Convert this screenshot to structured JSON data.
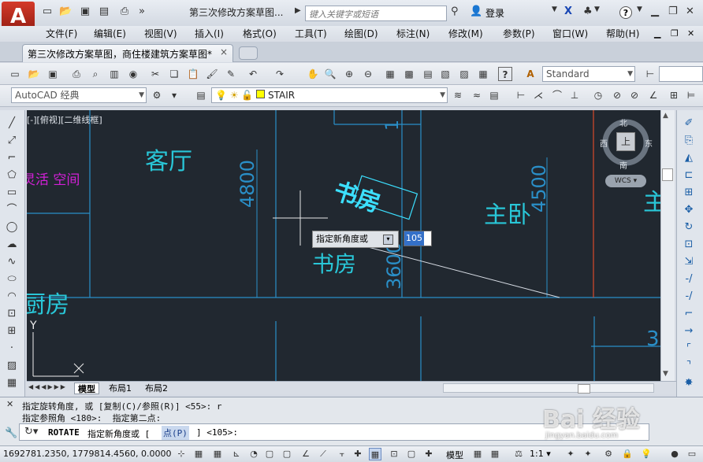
{
  "app": {
    "logo_letter": "A",
    "title": "第三次修改方案草图...",
    "search_placeholder": "键入关键字或短语",
    "login": "登录",
    "help": "?"
  },
  "menus": [
    "文件(F)",
    "编辑(E)",
    "视图(V)",
    "插入(I)",
    "格式(O)",
    "工具(T)",
    "绘图(D)",
    "标注(N)",
    "修改(M)",
    "参数(P)",
    "窗口(W)",
    "帮助(H)"
  ],
  "doc_tab": {
    "label": "第三次修改方案草图，商住楼建筑方案草图*",
    "close": "×"
  },
  "toolbar": {
    "text_style": "Standard",
    "workspace": "AutoCAD 经典",
    "layer": "STAIR"
  },
  "viewport_label": "[-][俯视][二维线框]",
  "viewcube": {
    "n": "北",
    "s": "南",
    "e": "东",
    "w": "西",
    "top": "上",
    "wcs": "WCS"
  },
  "drawing_text": {
    "living": "客厅",
    "flex": "灵活 空间",
    "kitchen": "厨房",
    "study": "书房",
    "study_rotated": "书房",
    "master": "主卧",
    "partial": "主",
    "dim_4800": "4800",
    "dim_4500": "4500",
    "dim_3600": "3600",
    "dim_3": "3",
    "dim_1": "1"
  },
  "dynamic_input": {
    "prompt": "指定新角度或",
    "value": "105"
  },
  "ucs": {
    "y": "Y",
    "x": "X"
  },
  "layout_tabs": [
    "模型",
    "布局1",
    "布局2"
  ],
  "command_history": [
    "指定旋转角度, 或 [复制(C)/参照(R)] <55>: r",
    "指定参照角 <180>:  指定第二点:"
  ],
  "command_input": {
    "cmd": "ROTATE",
    "prompt": "指定新角度或 [",
    "option": "点(P)",
    "tail": "] <105>:"
  },
  "status": {
    "coords": "1692781.2350, 1779814.4560, 0.0000",
    "model": "模型",
    "scale": "1:1"
  },
  "watermark": {
    "main": "Bai 经验",
    "sub": "jingyan.baidu.com"
  },
  "colors": {
    "canvas_bg": "#212830",
    "cyan_line": "#2a8fc8",
    "room_text": "#29c7d8",
    "magenta_text": "#d420d8",
    "highlight_text": "#3ce0ff",
    "red_line": "#d84a2a"
  }
}
